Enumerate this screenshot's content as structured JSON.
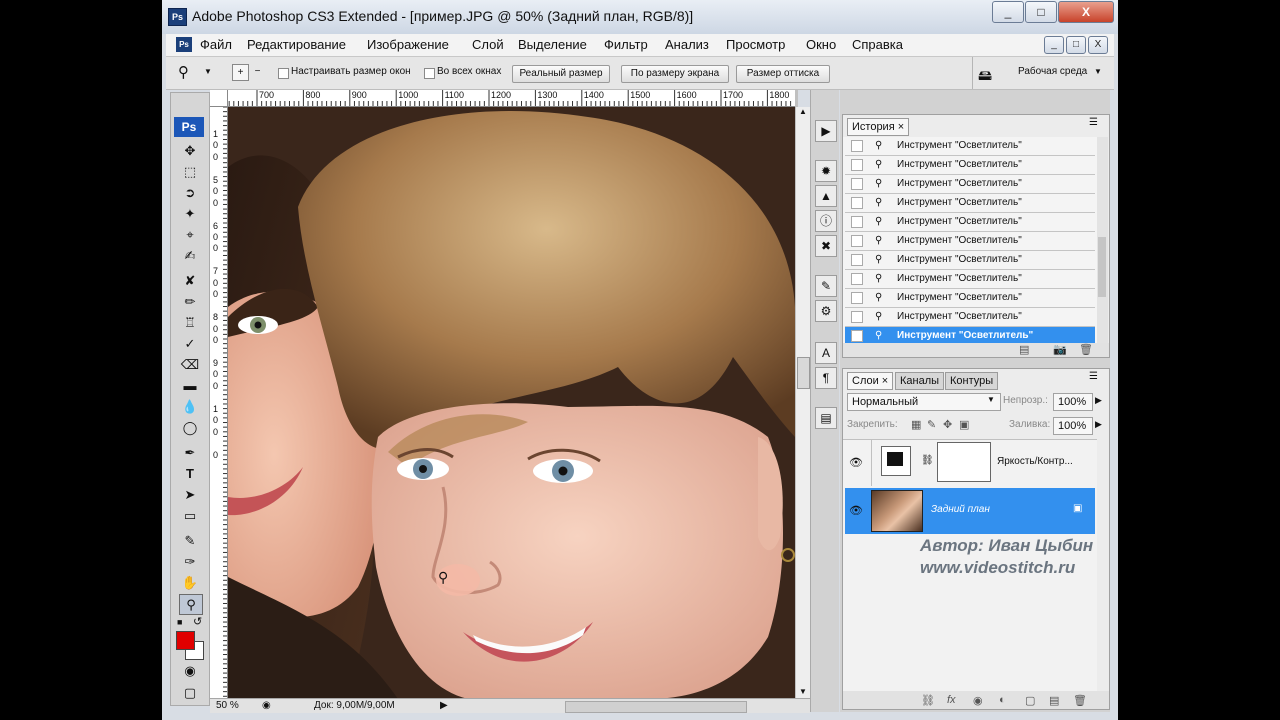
{
  "window": {
    "title": "Adobe Photoshop CS3 Extended - [пример.JPG @ 50% (Задний план, RGB/8)]",
    "app_icon": "Ps",
    "buttons": [
      "_",
      "□",
      "X"
    ]
  },
  "menubar": {
    "items": [
      "Файл",
      "Редактирование",
      "Изображение",
      "Слой",
      "Выделение",
      "Фильтр",
      "Анализ",
      "Просмотр",
      "Окно",
      "Справка"
    ],
    "doc_buttons": [
      "_",
      "□",
      "X"
    ]
  },
  "options": {
    "resize_windows_label": "Настраивать размер окон",
    "all_windows_label": "Во всех окнах",
    "actual_pixels": "Реальный размер",
    "fit_screen": "По размеру экрана",
    "print_size": "Размер оттиска",
    "workspace": "Рабочая среда"
  },
  "ruler": {
    "top_ticks": [
      "700",
      "800",
      "900",
      "1000",
      "1100",
      "1200",
      "1300",
      "1400",
      "1500",
      "1600",
      "1700",
      "1800"
    ],
    "left_ticks": [
      "1",
      "0",
      "0",
      "5",
      "0",
      "0",
      "6",
      "0",
      "0",
      "7",
      "0",
      "0",
      "8",
      "0",
      "0",
      "9",
      "0",
      "0",
      "1",
      "0",
      "0",
      "0"
    ]
  },
  "status": {
    "zoom": "50 %",
    "doc_size": "Док: 9,00M/9,00M"
  },
  "history": {
    "tab": "История",
    "items": [
      "Инструмент \"Осветлитель\"",
      "Инструмент \"Осветлитель\"",
      "Инструмент \"Осветлитель\"",
      "Инструмент \"Осветлитель\"",
      "Инструмент \"Осветлитель\"",
      "Инструмент \"Осветлитель\"",
      "Инструмент \"Осветлитель\"",
      "Инструмент \"Осветлитель\"",
      "Инструмент \"Осветлитель\"",
      "Инструмент \"Осветлитель\"",
      "Инструмент \"Осветлитель\""
    ],
    "selected_index": 10
  },
  "layers": {
    "tabs": [
      "Слои",
      "Каналы",
      "Контуры"
    ],
    "blend_mode": "Нормальный",
    "opacity_label": "Непрозр.:",
    "opacity": "100%",
    "lock_label": "Закрепить:",
    "fill_label": "Заливка:",
    "fill": "100%",
    "items": [
      {
        "name": "Яркость/Контр..."
      },
      {
        "name": "Задний план"
      }
    ]
  },
  "credit": {
    "author": "Автор: Иван Цыбин",
    "site": "www.videostitch.ru"
  },
  "colors": {
    "foreground": "#e00000",
    "background": "#ffffff",
    "selection": "#3390ee"
  }
}
